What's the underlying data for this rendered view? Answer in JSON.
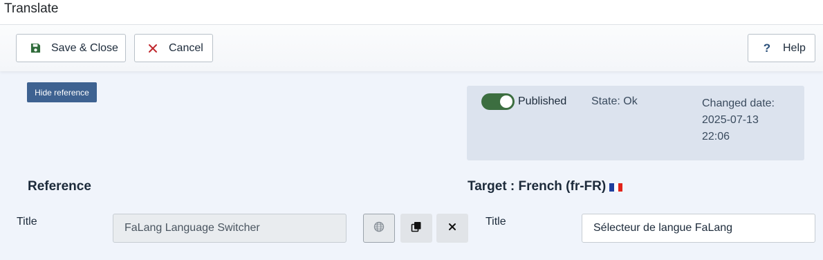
{
  "page": {
    "title": "Translate"
  },
  "toolbar": {
    "save_label": "Save & Close",
    "cancel_label": "Cancel",
    "help_label": "Help"
  },
  "reference_toggle": {
    "label": "Hide reference"
  },
  "status": {
    "published_label": "Published",
    "published_on": true,
    "state": "State: Ok",
    "changed_label": "Changed date:",
    "changed_date": "2025-07-13",
    "changed_time": "22:06"
  },
  "reference": {
    "heading": "Reference",
    "field_label": "Title",
    "value": "FaLang Language Switcher"
  },
  "target": {
    "heading": "Target : French (fr-FR)",
    "field_label": "Title",
    "value": "Sélecteur de langue FaLang"
  },
  "colors": {
    "primary": "#3e6291",
    "toggle_on": "#3c6e40",
    "save_icon": "#2f6b3a",
    "cancel_icon": "#c0272d",
    "panel_bg": "#dce3ee",
    "flag": [
      "#1f3f9e",
      "#ffffff",
      "#e2231a"
    ]
  },
  "icons": {
    "save": "floppy-disk-icon",
    "cancel": "close-icon",
    "help": "question-icon",
    "translate": "globe-icon",
    "copy": "copy-icon",
    "clear": "close-icon",
    "flag": "french-flag-icon"
  }
}
